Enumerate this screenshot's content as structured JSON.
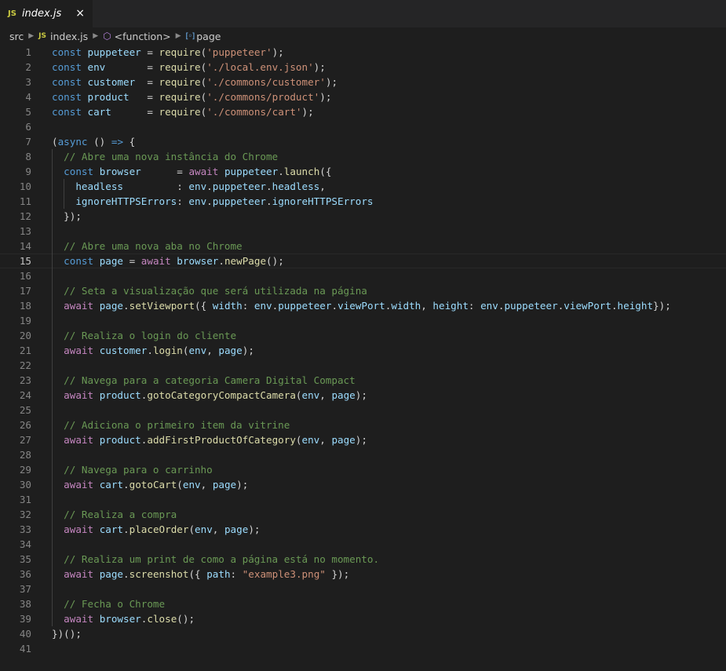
{
  "tab": {
    "icon": "JS",
    "label": "index.js",
    "close": "×"
  },
  "breadcrumb": {
    "folder": "src",
    "file_icon": "JS",
    "file": "index.js",
    "function_icon": "cube-icon",
    "function": "<function>",
    "variable_icon": "variable-icon",
    "variable": "page"
  },
  "current_line": 15,
  "lines": [
    [
      [
        "kw",
        "const"
      ],
      [
        "p",
        " "
      ],
      [
        "var",
        "puppeteer"
      ],
      [
        "p",
        " = "
      ],
      [
        "fn",
        "require"
      ],
      [
        "p",
        "("
      ],
      [
        "str",
        "'puppeteer'"
      ],
      [
        "p",
        ");"
      ]
    ],
    [
      [
        "kw",
        "const"
      ],
      [
        "p",
        " "
      ],
      [
        "var",
        "env"
      ],
      [
        "p",
        "       = "
      ],
      [
        "fn",
        "require"
      ],
      [
        "p",
        "("
      ],
      [
        "str",
        "'./local.env.json'"
      ],
      [
        "p",
        ");"
      ]
    ],
    [
      [
        "kw",
        "const"
      ],
      [
        "p",
        " "
      ],
      [
        "var",
        "customer"
      ],
      [
        "p",
        "  = "
      ],
      [
        "fn",
        "require"
      ],
      [
        "p",
        "("
      ],
      [
        "str",
        "'./commons/customer'"
      ],
      [
        "p",
        ");"
      ]
    ],
    [
      [
        "kw",
        "const"
      ],
      [
        "p",
        " "
      ],
      [
        "var",
        "product"
      ],
      [
        "p",
        "   = "
      ],
      [
        "fn",
        "require"
      ],
      [
        "p",
        "("
      ],
      [
        "str",
        "'./commons/product'"
      ],
      [
        "p",
        ");"
      ]
    ],
    [
      [
        "kw",
        "const"
      ],
      [
        "p",
        " "
      ],
      [
        "var",
        "cart"
      ],
      [
        "p",
        "      = "
      ],
      [
        "fn",
        "require"
      ],
      [
        "p",
        "("
      ],
      [
        "str",
        "'./commons/cart'"
      ],
      [
        "p",
        ");"
      ]
    ],
    [],
    [
      [
        "p",
        "("
      ],
      [
        "kw",
        "async"
      ],
      [
        "p",
        " () "
      ],
      [
        "kw",
        "=>"
      ],
      [
        "p",
        " {"
      ]
    ],
    [
      [
        "p",
        "  "
      ],
      [
        "cm",
        "// Abre uma nova instância do Chrome"
      ]
    ],
    [
      [
        "p",
        "  "
      ],
      [
        "kw",
        "const"
      ],
      [
        "p",
        " "
      ],
      [
        "var",
        "browser"
      ],
      [
        "p",
        "      = "
      ],
      [
        "ctl",
        "await"
      ],
      [
        "p",
        " "
      ],
      [
        "var",
        "puppeteer"
      ],
      [
        "p",
        "."
      ],
      [
        "fn",
        "launch"
      ],
      [
        "p",
        "({"
      ]
    ],
    [
      [
        "p",
        "    "
      ],
      [
        "var",
        "headless"
      ],
      [
        "p",
        "         : "
      ],
      [
        "var",
        "env"
      ],
      [
        "p",
        "."
      ],
      [
        "var",
        "puppeteer"
      ],
      [
        "p",
        "."
      ],
      [
        "var",
        "headless"
      ],
      [
        "p",
        ","
      ]
    ],
    [
      [
        "p",
        "    "
      ],
      [
        "var",
        "ignoreHTTPSErrors"
      ],
      [
        "p",
        ": "
      ],
      [
        "var",
        "env"
      ],
      [
        "p",
        "."
      ],
      [
        "var",
        "puppeteer"
      ],
      [
        "p",
        "."
      ],
      [
        "var",
        "ignoreHTTPSErrors"
      ]
    ],
    [
      [
        "p",
        "  });"
      ]
    ],
    [],
    [
      [
        "p",
        "  "
      ],
      [
        "cm",
        "// Abre uma nova aba no Chrome"
      ]
    ],
    [
      [
        "p",
        "  "
      ],
      [
        "kw",
        "const"
      ],
      [
        "p",
        " "
      ],
      [
        "var",
        "page"
      ],
      [
        "p",
        " = "
      ],
      [
        "ctl",
        "await"
      ],
      [
        "p",
        " "
      ],
      [
        "var",
        "browser"
      ],
      [
        "p",
        "."
      ],
      [
        "fn",
        "newPage"
      ],
      [
        "p",
        "();"
      ]
    ],
    [],
    [
      [
        "p",
        "  "
      ],
      [
        "cm",
        "// Seta a visualização que será utilizada na página"
      ]
    ],
    [
      [
        "p",
        "  "
      ],
      [
        "ctl",
        "await"
      ],
      [
        "p",
        " "
      ],
      [
        "var",
        "page"
      ],
      [
        "p",
        "."
      ],
      [
        "fn",
        "setViewport"
      ],
      [
        "p",
        "({ "
      ],
      [
        "var",
        "width"
      ],
      [
        "p",
        ": "
      ],
      [
        "var",
        "env"
      ],
      [
        "p",
        "."
      ],
      [
        "var",
        "puppeteer"
      ],
      [
        "p",
        "."
      ],
      [
        "var",
        "viewPort"
      ],
      [
        "p",
        "."
      ],
      [
        "var",
        "width"
      ],
      [
        "p",
        ", "
      ],
      [
        "var",
        "height"
      ],
      [
        "p",
        ": "
      ],
      [
        "var",
        "env"
      ],
      [
        "p",
        "."
      ],
      [
        "var",
        "puppeteer"
      ],
      [
        "p",
        "."
      ],
      [
        "var",
        "viewPort"
      ],
      [
        "p",
        "."
      ],
      [
        "var",
        "height"
      ],
      [
        "p",
        "});"
      ]
    ],
    [],
    [
      [
        "p",
        "  "
      ],
      [
        "cm",
        "// Realiza o login do cliente"
      ]
    ],
    [
      [
        "p",
        "  "
      ],
      [
        "ctl",
        "await"
      ],
      [
        "p",
        " "
      ],
      [
        "var",
        "customer"
      ],
      [
        "p",
        "."
      ],
      [
        "fn",
        "login"
      ],
      [
        "p",
        "("
      ],
      [
        "var",
        "env"
      ],
      [
        "p",
        ", "
      ],
      [
        "var",
        "page"
      ],
      [
        "p",
        ");"
      ]
    ],
    [],
    [
      [
        "p",
        "  "
      ],
      [
        "cm",
        "// Navega para a categoria Camera Digital Compact"
      ]
    ],
    [
      [
        "p",
        "  "
      ],
      [
        "ctl",
        "await"
      ],
      [
        "p",
        " "
      ],
      [
        "var",
        "product"
      ],
      [
        "p",
        "."
      ],
      [
        "fn",
        "gotoCategoryCompactCamera"
      ],
      [
        "p",
        "("
      ],
      [
        "var",
        "env"
      ],
      [
        "p",
        ", "
      ],
      [
        "var",
        "page"
      ],
      [
        "p",
        ");"
      ]
    ],
    [],
    [
      [
        "p",
        "  "
      ],
      [
        "cm",
        "// Adiciona o primeiro item da vitrine"
      ]
    ],
    [
      [
        "p",
        "  "
      ],
      [
        "ctl",
        "await"
      ],
      [
        "p",
        " "
      ],
      [
        "var",
        "product"
      ],
      [
        "p",
        "."
      ],
      [
        "fn",
        "addFirstProductOfCategory"
      ],
      [
        "p",
        "("
      ],
      [
        "var",
        "env"
      ],
      [
        "p",
        ", "
      ],
      [
        "var",
        "page"
      ],
      [
        "p",
        ");"
      ]
    ],
    [],
    [
      [
        "p",
        "  "
      ],
      [
        "cm",
        "// Navega para o carrinho"
      ]
    ],
    [
      [
        "p",
        "  "
      ],
      [
        "ctl",
        "await"
      ],
      [
        "p",
        " "
      ],
      [
        "var",
        "cart"
      ],
      [
        "p",
        "."
      ],
      [
        "fn",
        "gotoCart"
      ],
      [
        "p",
        "("
      ],
      [
        "var",
        "env"
      ],
      [
        "p",
        ", "
      ],
      [
        "var",
        "page"
      ],
      [
        "p",
        ");"
      ]
    ],
    [],
    [
      [
        "p",
        "  "
      ],
      [
        "cm",
        "// Realiza a compra"
      ]
    ],
    [
      [
        "p",
        "  "
      ],
      [
        "ctl",
        "await"
      ],
      [
        "p",
        " "
      ],
      [
        "var",
        "cart"
      ],
      [
        "p",
        "."
      ],
      [
        "fn",
        "placeOrder"
      ],
      [
        "p",
        "("
      ],
      [
        "var",
        "env"
      ],
      [
        "p",
        ", "
      ],
      [
        "var",
        "page"
      ],
      [
        "p",
        ");"
      ]
    ],
    [],
    [
      [
        "p",
        "  "
      ],
      [
        "cm",
        "// Realiza um print de como a página está no momento."
      ]
    ],
    [
      [
        "p",
        "  "
      ],
      [
        "ctl",
        "await"
      ],
      [
        "p",
        " "
      ],
      [
        "var",
        "page"
      ],
      [
        "p",
        "."
      ],
      [
        "fn",
        "screenshot"
      ],
      [
        "p",
        "({ "
      ],
      [
        "var",
        "path"
      ],
      [
        "p",
        ": "
      ],
      [
        "str",
        "\"example3.png\""
      ],
      [
        "p",
        " });"
      ]
    ],
    [],
    [
      [
        "p",
        "  "
      ],
      [
        "cm",
        "// Fecha o Chrome"
      ]
    ],
    [
      [
        "p",
        "  "
      ],
      [
        "ctl",
        "await"
      ],
      [
        "p",
        " "
      ],
      [
        "var",
        "browser"
      ],
      [
        "p",
        "."
      ],
      [
        "fn",
        "close"
      ],
      [
        "p",
        "();"
      ]
    ],
    [
      [
        "p",
        "})();"
      ]
    ],
    []
  ]
}
